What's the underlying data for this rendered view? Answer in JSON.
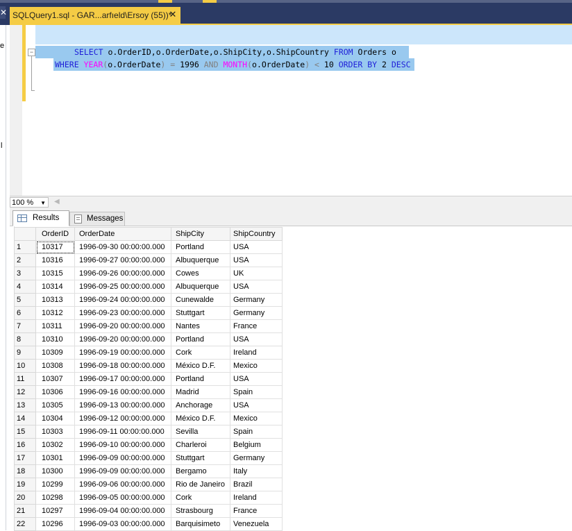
{
  "window": {
    "doc_tab_title": "SQLQuery1.sql - GAR...arfıeld\\Ersoy (55))*",
    "close_glyph": "✕",
    "left_close_glyph": "✕",
    "left_edge_glyphs": [
      "e",
      "l"
    ]
  },
  "editor": {
    "collapse_glyph": "−",
    "line1": {
      "k_select": "SELECT",
      "t_cols": " o.OrderID,o.OrderDate,o.ShipCity,o.ShipCountry ",
      "k_from": "FROM",
      "t_table": " Orders o"
    },
    "line2": {
      "k_where": "WHERE",
      "sp1": " ",
      "f_year": "YEAR",
      "p1": "(",
      "t_col1": "o.OrderDate",
      "p2": ")",
      "eq": " = ",
      "t_1996": "1996",
      "sp2": " ",
      "k_and": "AND",
      "sp3": " ",
      "f_month": "MONTH",
      "p3": "(",
      "t_col2": "o.OrderDate",
      "p4": ")",
      "lt": " < ",
      "t_10": "10",
      "sp4": " ",
      "k_order": "ORDER BY",
      "t_2": " 2 ",
      "k_desc": "DESC"
    }
  },
  "zoom": {
    "value": "100 %",
    "arrow": "▼",
    "scroll_left": "◀"
  },
  "results_tabs": {
    "results": "Results",
    "messages": "Messages"
  },
  "grid": {
    "columns": [
      "OrderID",
      "OrderDate",
      "ShipCity",
      "ShipCountry"
    ],
    "rows": [
      [
        "1",
        "10317",
        "1996-09-30 00:00:00.000",
        "Portland",
        "USA"
      ],
      [
        "2",
        "10316",
        "1996-09-27 00:00:00.000",
        "Albuquerque",
        "USA"
      ],
      [
        "3",
        "10315",
        "1996-09-26 00:00:00.000",
        "Cowes",
        "UK"
      ],
      [
        "4",
        "10314",
        "1996-09-25 00:00:00.000",
        "Albuquerque",
        "USA"
      ],
      [
        "5",
        "10313",
        "1996-09-24 00:00:00.000",
        "Cunewalde",
        "Germany"
      ],
      [
        "6",
        "10312",
        "1996-09-23 00:00:00.000",
        "Stuttgart",
        "Germany"
      ],
      [
        "7",
        "10311",
        "1996-09-20 00:00:00.000",
        "Nantes",
        "France"
      ],
      [
        "8",
        "10310",
        "1996-09-20 00:00:00.000",
        "Portland",
        "USA"
      ],
      [
        "9",
        "10309",
        "1996-09-19 00:00:00.000",
        "Cork",
        "Ireland"
      ],
      [
        "10",
        "10308",
        "1996-09-18 00:00:00.000",
        "México D.F.",
        "Mexico"
      ],
      [
        "11",
        "10307",
        "1996-09-17 00:00:00.000",
        "Portland",
        "USA"
      ],
      [
        "12",
        "10306",
        "1996-09-16 00:00:00.000",
        "Madrid",
        "Spain"
      ],
      [
        "13",
        "10305",
        "1996-09-13 00:00:00.000",
        "Anchorage",
        "USA"
      ],
      [
        "14",
        "10304",
        "1996-09-12 00:00:00.000",
        "México D.F.",
        "Mexico"
      ],
      [
        "15",
        "10303",
        "1996-09-11 00:00:00.000",
        "Sevilla",
        "Spain"
      ],
      [
        "16",
        "10302",
        "1996-09-10 00:00:00.000",
        "Charleroi",
        "Belgium"
      ],
      [
        "17",
        "10301",
        "1996-09-09 00:00:00.000",
        "Stuttgart",
        "Germany"
      ],
      [
        "18",
        "10300",
        "1996-09-09 00:00:00.000",
        "Bergamo",
        "Italy"
      ],
      [
        "19",
        "10299",
        "1996-09-06 00:00:00.000",
        "Rio de Janeiro",
        "Brazil"
      ],
      [
        "20",
        "10298",
        "1996-09-05 00:00:00.000",
        "Cork",
        "Ireland"
      ],
      [
        "21",
        "10297",
        "1996-09-04 00:00:00.000",
        "Strasbourg",
        "France"
      ],
      [
        "22",
        "10296",
        "1996-09-03 00:00:00.000",
        "Barquisimeto",
        "Venezuela"
      ]
    ]
  },
  "colors": {
    "tab_active": "#f5cc45",
    "chrome_dark": "#2b3a64",
    "selection": "#99c9ef",
    "keyword": "#1e1ed8",
    "function": "#ff00ff",
    "operator": "#808080"
  }
}
